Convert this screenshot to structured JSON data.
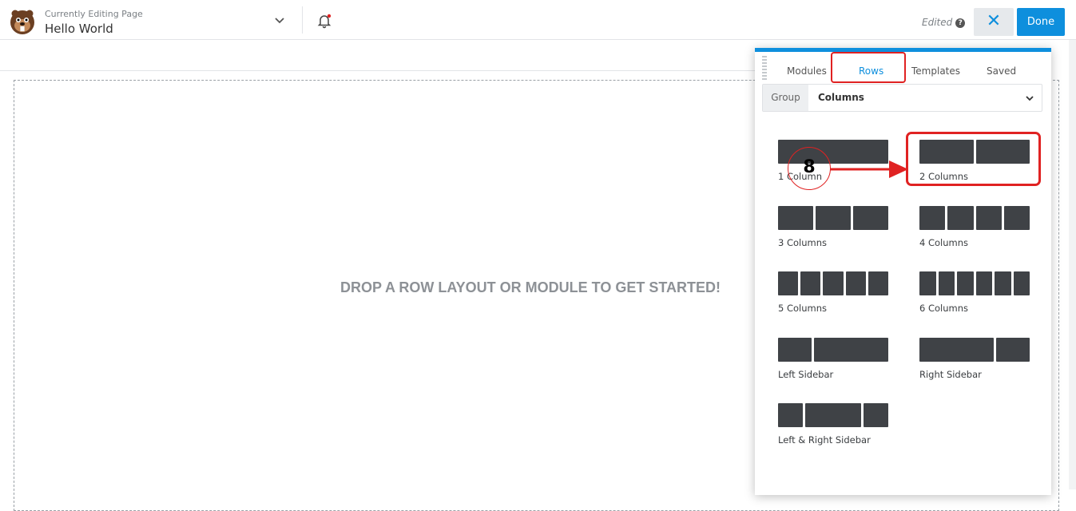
{
  "header": {
    "editing_label": "Currently Editing Page",
    "page_title": "Hello World",
    "status": "Edited",
    "help_glyph": "?",
    "close_glyph": "✕",
    "done_label": "Done"
  },
  "canvas": {
    "drop_message": "DROP A ROW LAYOUT OR MODULE TO GET STARTED!"
  },
  "panel": {
    "tabs": [
      {
        "label": "Modules",
        "active": false
      },
      {
        "label": "Rows",
        "active": true
      },
      {
        "label": "Templates",
        "active": false
      },
      {
        "label": "Saved",
        "active": false
      }
    ],
    "group": {
      "label": "Group",
      "value": "Columns"
    },
    "layouts": [
      {
        "label": "1 Column"
      },
      {
        "label": "2 Columns"
      },
      {
        "label": "3 Columns"
      },
      {
        "label": "4 Columns"
      },
      {
        "label": "5 Columns"
      },
      {
        "label": "6 Columns"
      },
      {
        "label": "Left Sidebar"
      },
      {
        "label": "Right Sidebar"
      },
      {
        "label": "Left & Right Sidebar"
      }
    ]
  },
  "annotation": {
    "step_number": "8"
  },
  "colors": {
    "accent": "#0e8fdd",
    "highlight": "#e02222",
    "block": "#3f4246"
  }
}
